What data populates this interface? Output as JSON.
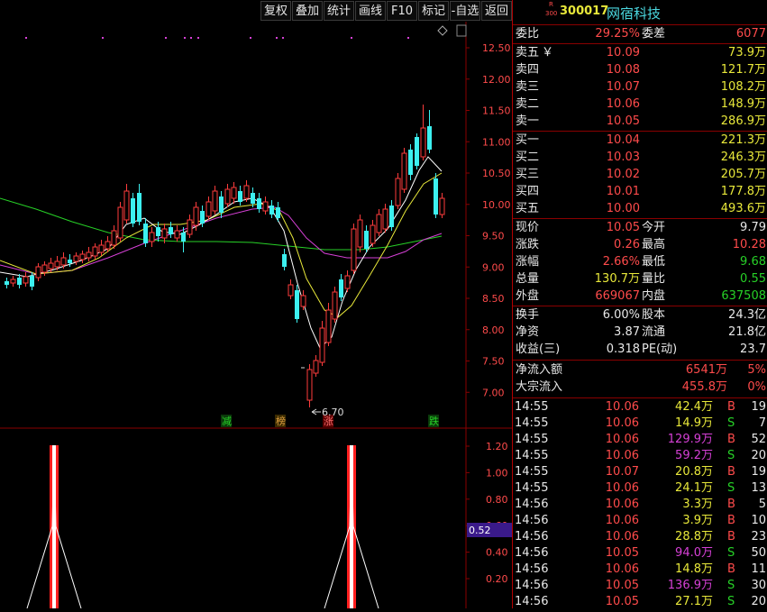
{
  "toolbar": {
    "buttons": [
      "复权",
      "叠加",
      "统计",
      "画线",
      "F10",
      "标记",
      "-自选",
      "返回"
    ]
  },
  "stock": {
    "badge_top": "R",
    "badge_bottom": "300",
    "code": "300017",
    "name": "网宿科技"
  },
  "weibi": {
    "label1": "委比",
    "value1": "29.25%",
    "label2": "委差",
    "value2": "6077"
  },
  "sell_orders": [
    {
      "label": "卖五",
      "extra": "￥",
      "price": "10.09",
      "volume": "73.9万"
    },
    {
      "label": "卖四",
      "extra": "",
      "price": "10.08",
      "volume": "121.7万"
    },
    {
      "label": "卖三",
      "extra": "",
      "price": "10.07",
      "volume": "108.2万"
    },
    {
      "label": "卖二",
      "extra": "",
      "price": "10.06",
      "volume": "148.9万"
    },
    {
      "label": "卖一",
      "extra": "",
      "price": "10.05",
      "volume": "286.9万"
    }
  ],
  "buy_orders": [
    {
      "label": "买一",
      "price": "10.04",
      "volume": "221.3万"
    },
    {
      "label": "买二",
      "price": "10.03",
      "volume": "246.3万"
    },
    {
      "label": "买三",
      "price": "10.02",
      "volume": "205.7万"
    },
    {
      "label": "买四",
      "price": "10.01",
      "volume": "177.8万"
    },
    {
      "label": "买五",
      "price": "10.00",
      "volume": "493.6万"
    }
  ],
  "quote": [
    {
      "l1": "现价",
      "v1": "10.05",
      "c1": "red",
      "l2": "今开",
      "v2": "9.79",
      "c2": "white"
    },
    {
      "l1": "涨跌",
      "v1": "0.26",
      "c1": "red",
      "l2": "最高",
      "v2": "10.28",
      "c2": "red"
    },
    {
      "l1": "涨幅",
      "v1": "2.66%",
      "c1": "red",
      "l2": "最低",
      "v2": "9.68",
      "c2": "green"
    },
    {
      "l1": "总量",
      "v1": "130.7万",
      "c1": "yellow",
      "l2": "量比",
      "v2": "0.55",
      "c2": "green"
    },
    {
      "l1": "外盘",
      "v1": "669067",
      "c1": "red",
      "l2": "内盘",
      "v2": "637508",
      "c2": "green"
    }
  ],
  "fundamentals": [
    {
      "l1": "换手",
      "v1": "6.00%",
      "l2": "股本",
      "v2": "24.3亿"
    },
    {
      "l1": "净资",
      "v1": "3.87",
      "l2": "流通",
      "v2": "21.8亿"
    },
    {
      "l1": "收益(三)",
      "v1": "0.318",
      "l2": "PE(动)",
      "v2": "23.7"
    }
  ],
  "flows": [
    {
      "label": "净流入额",
      "value": "6541万",
      "pct": "5%"
    },
    {
      "label": "大宗流入",
      "value": "455.8万",
      "pct": "0%"
    }
  ],
  "ticks": [
    {
      "time": "14:55",
      "price": "10.06",
      "vol": "42.4万",
      "vc": "yellow",
      "dir": "B",
      "n": "19"
    },
    {
      "time": "14:55",
      "price": "10.06",
      "vol": "14.9万",
      "vc": "yellow",
      "dir": "S",
      "n": "7"
    },
    {
      "time": "14:55",
      "price": "10.06",
      "vol": "129.9万",
      "vc": "magenta",
      "dir": "B",
      "n": "52"
    },
    {
      "time": "14:55",
      "price": "10.06",
      "vol": "59.2万",
      "vc": "magenta",
      "dir": "S",
      "n": "20"
    },
    {
      "time": "14:55",
      "price": "10.07",
      "vol": "20.8万",
      "vc": "yellow",
      "dir": "B",
      "n": "19"
    },
    {
      "time": "14:55",
      "price": "10.06",
      "vol": "24.1万",
      "vc": "yellow",
      "dir": "S",
      "n": "13"
    },
    {
      "time": "14:56",
      "price": "10.06",
      "vol": "3.3万",
      "vc": "yellow",
      "dir": "B",
      "n": "5"
    },
    {
      "time": "14:56",
      "price": "10.06",
      "vol": "3.9万",
      "vc": "yellow",
      "dir": "B",
      "n": "10"
    },
    {
      "time": "14:56",
      "price": "10.06",
      "vol": "28.8万",
      "vc": "yellow",
      "dir": "B",
      "n": "23"
    },
    {
      "time": "14:56",
      "price": "10.05",
      "vol": "94.0万",
      "vc": "magenta",
      "dir": "S",
      "n": "50"
    },
    {
      "time": "14:56",
      "price": "10.06",
      "vol": "14.8万",
      "vc": "yellow",
      "dir": "B",
      "n": "11"
    },
    {
      "time": "14:56",
      "price": "10.05",
      "vol": "136.9万",
      "vc": "magenta",
      "dir": "S",
      "n": "30"
    },
    {
      "time": "14:56",
      "price": "10.05",
      "vol": "27.1万",
      "vc": "yellow",
      "dir": "S",
      "n": "20"
    }
  ],
  "price_axis": [
    "12.50",
    "12.00",
    "11.50",
    "11.00",
    "10.50",
    "10.00",
    "9.50",
    "9.00",
    "8.50",
    "8.00",
    "7.50",
    "7.00"
  ],
  "low_label": "6.70",
  "markers": [
    "减",
    "榜",
    "涨",
    "跌"
  ],
  "indicator_axis": [
    "1.20",
    "1.00",
    "0.80",
    "0.60",
    "0.40",
    "0.20"
  ],
  "indicator_value": "0.52",
  "colors": {
    "up": "#ff3c3c",
    "down": "#3cf0f0",
    "ma5": "#ffffff",
    "ma10": "#e8e83a",
    "ma20": "#d640d6",
    "ma60": "#27d127",
    "divider": "#b00000"
  }
}
